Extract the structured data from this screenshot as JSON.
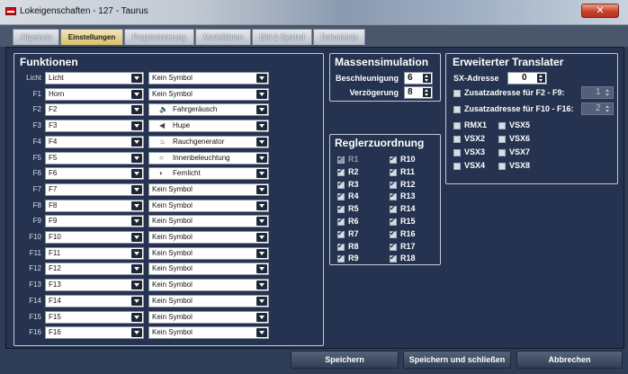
{
  "window": {
    "title": "Lokeigenschaften - 127 - Taurus",
    "close_label": "✕"
  },
  "tabs": [
    {
      "label": "Allgemein",
      "active": false
    },
    {
      "label": "Einstellungen",
      "active": true
    },
    {
      "label": "Programmierung",
      "active": false
    },
    {
      "label": "Modelldaten",
      "active": false
    },
    {
      "label": "Bild & Symbol",
      "active": false
    },
    {
      "label": "Dokumente",
      "active": false
    }
  ],
  "funktionen": {
    "title": "Funktionen",
    "rows": [
      {
        "label": "Licht",
        "func": "Licht",
        "symbol": "Kein Symbol",
        "icon": ""
      },
      {
        "label": "F1",
        "func": "Horn",
        "symbol": "Kein Symbol",
        "icon": ""
      },
      {
        "label": "F2",
        "func": "F2",
        "symbol": "Fahrgeräusch",
        "icon": "speaker-icon"
      },
      {
        "label": "F3",
        "func": "F3",
        "symbol": "Hupe",
        "icon": "horn-icon"
      },
      {
        "label": "F4",
        "func": "F4",
        "symbol": "Rauchgenerator",
        "icon": "smoke-icon"
      },
      {
        "label": "F5",
        "func": "F5",
        "symbol": "Innenbeleuchtung",
        "icon": "bulb-icon"
      },
      {
        "label": "F6",
        "func": "F6",
        "symbol": "Fernlicht",
        "icon": "headlight-icon"
      },
      {
        "label": "F7",
        "func": "F7",
        "symbol": "Kein Symbol",
        "icon": ""
      },
      {
        "label": "F8",
        "func": "F8",
        "symbol": "Kein Symbol",
        "icon": ""
      },
      {
        "label": "F9",
        "func": "F9",
        "symbol": "Kein Symbol",
        "icon": ""
      },
      {
        "label": "F10",
        "func": "F10",
        "symbol": "Kein Symbol",
        "icon": ""
      },
      {
        "label": "F11",
        "func": "F11",
        "symbol": "Kein Symbol",
        "icon": ""
      },
      {
        "label": "F12",
        "func": "F12",
        "symbol": "Kein Symbol",
        "icon": ""
      },
      {
        "label": "F13",
        "func": "F13",
        "symbol": "Kein Symbol",
        "icon": ""
      },
      {
        "label": "F14",
        "func": "F14",
        "symbol": "Kein Symbol",
        "icon": ""
      },
      {
        "label": "F15",
        "func": "F15",
        "symbol": "Kein Symbol",
        "icon": ""
      },
      {
        "label": "F16",
        "func": "F16",
        "symbol": "Kein Symbol",
        "icon": ""
      }
    ]
  },
  "massensimulation": {
    "title": "Massensimulation",
    "beschleunigung_label": "Beschleunigung",
    "beschleunigung_value": "6",
    "verzoegerung_label": "Verzögerung",
    "verzoegerung_value": "8"
  },
  "reglerzuordnung": {
    "title": "Reglerzuordnung",
    "items": [
      {
        "label": "R1",
        "checked": true,
        "disabled": true
      },
      {
        "label": "R10",
        "checked": true,
        "disabled": false
      },
      {
        "label": "R2",
        "checked": true,
        "disabled": false
      },
      {
        "label": "R11",
        "checked": true,
        "disabled": false
      },
      {
        "label": "R3",
        "checked": true,
        "disabled": false
      },
      {
        "label": "R12",
        "checked": true,
        "disabled": false
      },
      {
        "label": "R4",
        "checked": true,
        "disabled": false
      },
      {
        "label": "R13",
        "checked": true,
        "disabled": false
      },
      {
        "label": "R5",
        "checked": true,
        "disabled": false
      },
      {
        "label": "R14",
        "checked": true,
        "disabled": false
      },
      {
        "label": "R6",
        "checked": true,
        "disabled": false
      },
      {
        "label": "R15",
        "checked": true,
        "disabled": false
      },
      {
        "label": "R7",
        "checked": true,
        "disabled": false
      },
      {
        "label": "R16",
        "checked": true,
        "disabled": false
      },
      {
        "label": "R8",
        "checked": true,
        "disabled": false
      },
      {
        "label": "R17",
        "checked": true,
        "disabled": false
      },
      {
        "label": "R9",
        "checked": true,
        "disabled": false
      },
      {
        "label": "R18",
        "checked": true,
        "disabled": false
      }
    ]
  },
  "translater": {
    "title": "Erweiterter Translater",
    "sx_label": "SX-Adresse",
    "sx_value": "0",
    "zusatz1_label": "Zusatzadresse für F2 - F9:",
    "zusatz1_value": "1",
    "zusatz2_label": "Zusatzadresse für F10 - F16:",
    "zusatz2_value": "2",
    "checks": [
      "RMX1",
      "VSX5",
      "VSX2",
      "VSX6",
      "VSX3",
      "VSX7",
      "VSX4",
      "VSX8"
    ]
  },
  "buttons": {
    "save": "Speichern",
    "save_close": "Speichern und schließen",
    "cancel": "Abbrechen"
  },
  "colors": {
    "background": "#253350",
    "frame": "#c3cad6",
    "active_tab": "#d9bf6a"
  }
}
